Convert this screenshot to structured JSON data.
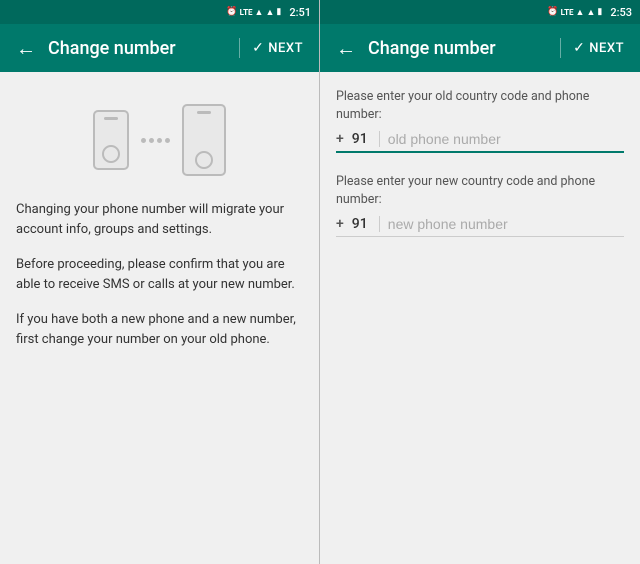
{
  "screen1": {
    "statusBar": {
      "time": "2:51",
      "icons": [
        "alarm",
        "lte",
        "signal",
        "wifi",
        "battery"
      ]
    },
    "toolbar": {
      "backLabel": "←",
      "title": "Change number",
      "divider": "|",
      "nextCheckmark": "✓",
      "nextLabel": "NEXT"
    },
    "illustration": {
      "alt": "Two phones migrating data"
    },
    "paragraphs": [
      "Changing your phone number will migrate your account info, groups and settings.",
      "Before proceeding, please confirm that you are able to receive SMS or calls at your new number.",
      "If you have both a new phone and a new number, first change your number on your old phone."
    ]
  },
  "screen2": {
    "statusBar": {
      "time": "2:53",
      "icons": [
        "alarm",
        "lte",
        "signal",
        "wifi",
        "battery"
      ]
    },
    "toolbar": {
      "backLabel": "←",
      "title": "Change number",
      "divider": "|",
      "nextCheckmark": "✓",
      "nextLabel": "NEXT"
    },
    "oldNumber": {
      "label": "Please enter your old country code and phone number:",
      "plus": "+",
      "countryCode": "91",
      "placeholder": "old phone number"
    },
    "newNumber": {
      "label": "Please enter your new country code and phone number:",
      "plus": "+",
      "countryCode": "91",
      "placeholder": "new phone number"
    }
  }
}
